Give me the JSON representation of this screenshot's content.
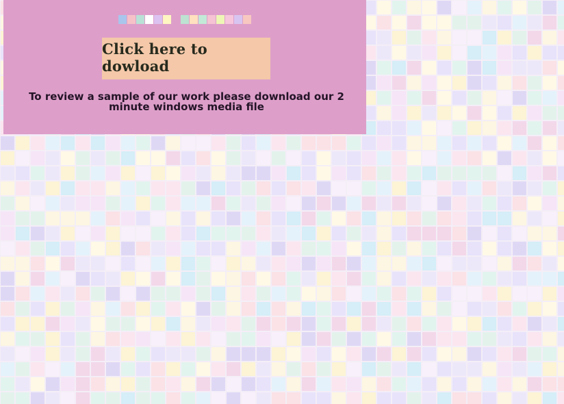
{
  "panel": {
    "download_label": "Click here to dowload",
    "description": "To review a sample of our work please download our 2 minute windows media file",
    "background_color": "#dd9fca",
    "button_color": "#f4c8a9"
  },
  "swatches": [
    "#a9c5ec",
    "#f6c2c8",
    "#b9e1d6",
    "#ffffff",
    "#dcc2f1",
    "#fff6c2",
    "gap",
    "#bde2d2",
    "#ffe0bf",
    "#c2e9d7",
    "#f5c3d3",
    "#eef6b6",
    "#f7c6dd",
    "#d8c4f0",
    "#f8c8c0"
  ],
  "background_tile_colors": [
    "#fbe5ef",
    "#e8e3fb",
    "#fdf6e2",
    "#e3f3ec",
    "#e4f2fb",
    "#f6e4f7",
    "#fff9e6",
    "#fbe2e6",
    "#dfd8f5",
    "#d5eef8",
    "#f8f0fa",
    "#ede7fa",
    "#f3d8ea",
    "#fcf4d4",
    "#e2f4ee"
  ]
}
